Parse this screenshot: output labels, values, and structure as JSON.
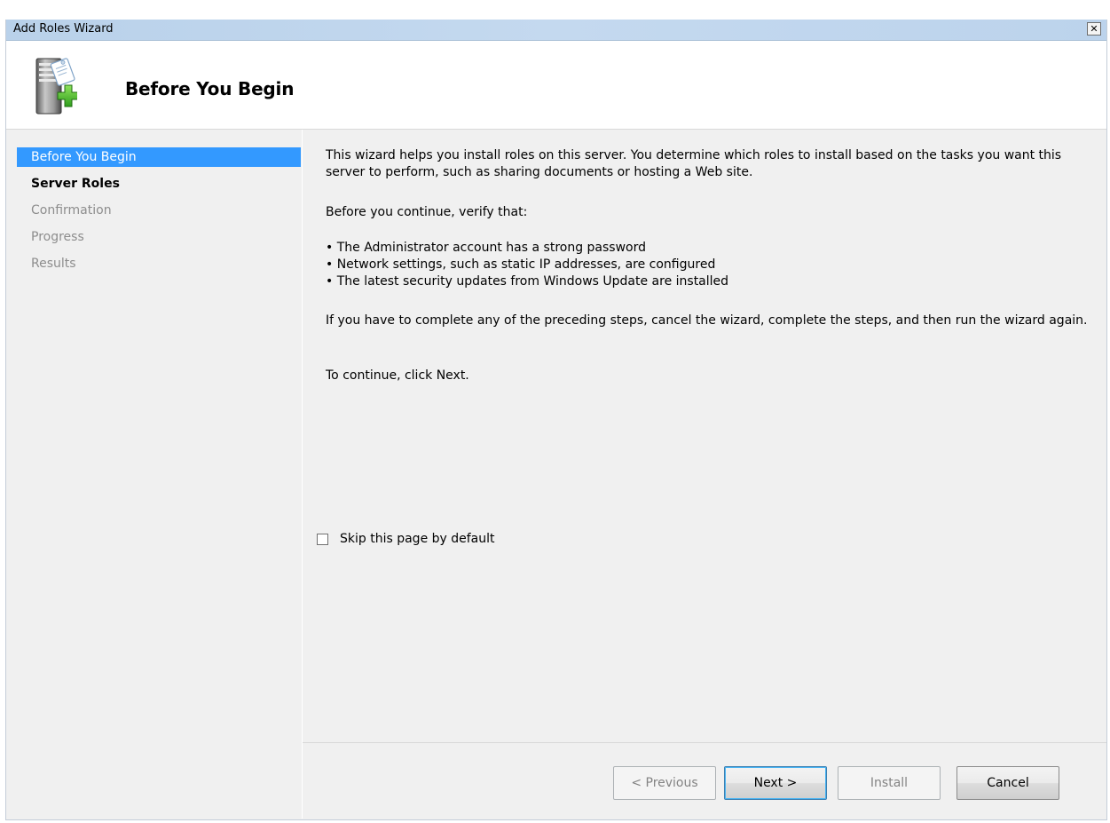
{
  "window": {
    "title": "Add Roles Wizard",
    "close_glyph": "✕"
  },
  "header": {
    "title": "Before You Begin",
    "icon": "server-add-icon"
  },
  "nav": {
    "items": [
      {
        "label": "Before You Begin",
        "state": "active"
      },
      {
        "label": "Server Roles",
        "state": "bold"
      },
      {
        "label": "Confirmation",
        "state": "disabled"
      },
      {
        "label": "Progress",
        "state": "disabled"
      },
      {
        "label": "Results",
        "state": "disabled"
      }
    ]
  },
  "content": {
    "intro": "This wizard helps you install roles on this server. You determine which roles to install based on the tasks you want this server to perform, such as sharing documents or hosting a Web site.",
    "verify_heading": "Before you continue, verify that:",
    "bullets": [
      "• The Administrator account has a strong password",
      "• Network settings, such as static IP addresses, are configured",
      "• The latest security updates from Windows Update are installed"
    ],
    "cancel_note": "If you have to complete any of the preceding steps, cancel the wizard, complete the steps, and then run the wizard again.",
    "continue_note": "To continue, click Next.",
    "skip_checkbox": {
      "label": "Skip this page by default",
      "checked": false
    }
  },
  "buttons": {
    "previous": "< Previous",
    "next": "Next >",
    "install": "Install",
    "cancel": "Cancel"
  }
}
